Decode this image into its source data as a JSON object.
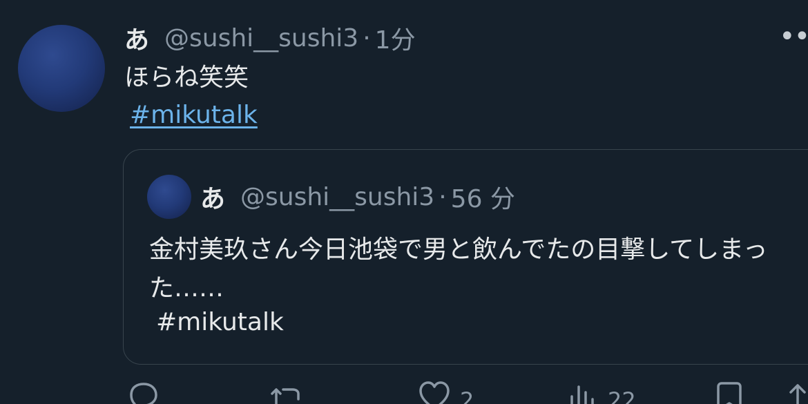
{
  "tweet": {
    "name": "あ",
    "handle": "@sushi__sushi3",
    "separator": "·",
    "time": "1分",
    "text": "ほらね笑笑",
    "hashtag": "#mikutalk",
    "more_icon": "more-icon"
  },
  "quoted": {
    "name": "あ",
    "handle": "@sushi__sushi3",
    "separator": "·",
    "time": "56 分",
    "text": "金村美玖さん今日池袋で男と飲んでたの目撃してしまった……",
    "hashtag": "#mikutalk"
  },
  "actions": {
    "reply_icon": "reply-icon",
    "retweet_icon": "retweet-icon",
    "like_icon": "like-icon",
    "like_count": "2",
    "views_icon": "views-icon",
    "views_count": "22",
    "bookmark_icon": "bookmark-icon",
    "share_icon": "share-icon"
  },
  "colors": {
    "background": "#15202b",
    "text": "#e7e9ea",
    "secondary": "#8b98a5",
    "link": "#6cb3ea",
    "border": "#38444d"
  }
}
